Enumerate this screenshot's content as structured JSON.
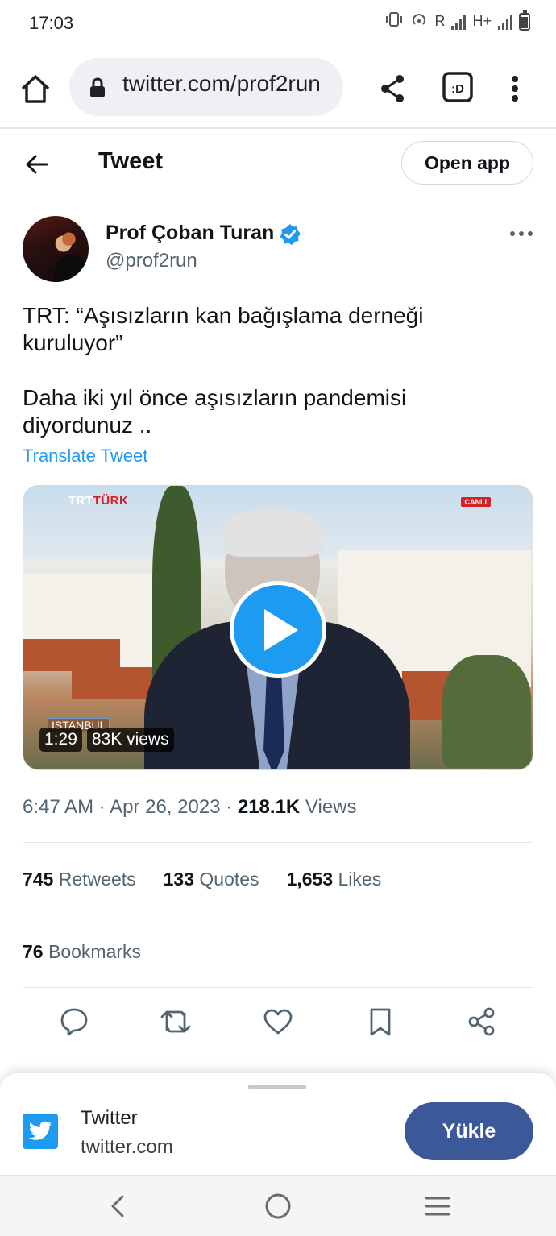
{
  "status_bar": {
    "time": "17:03",
    "network_label": "R",
    "network_type": "H+"
  },
  "browser": {
    "url": "twitter.com/prof2run"
  },
  "header": {
    "title": "Tweet",
    "open_app_label": "Open app"
  },
  "tweet": {
    "author_name": "Prof Çoban Turan",
    "author_handle": "@prof2run",
    "text": "TRT: “Aşısızların kan bağışlama derneği kuruluyor”\n\nDaha iki yıl önce aşısızların pandemisi diyordunuz ..",
    "translate_label": "Translate Tweet",
    "media": {
      "channel_logo_white": "TRT",
      "channel_logo_red": "TÜRK",
      "live_badge": "CANLI",
      "location_tag": "İSTANBUL",
      "duration": "1:29",
      "views": "83K views"
    },
    "time": "6:47 AM",
    "date": "Apr 26, 2023",
    "views_count": "218.1K",
    "views_label": "Views",
    "retweets_count": "745",
    "retweets_label": "Retweets",
    "quotes_count": "133",
    "quotes_label": "Quotes",
    "likes_count": "1,653",
    "likes_label": "Likes",
    "bookmarks_count": "76",
    "bookmarks_label": "Bookmarks"
  },
  "install_sheet": {
    "app_name": "Twitter",
    "domain": "twitter.com",
    "install_label": "Yükle"
  },
  "colors": {
    "accent": "#1d9bf0",
    "install_button": "#3b5998",
    "text_primary": "#0f1419",
    "text_secondary": "#536471"
  }
}
